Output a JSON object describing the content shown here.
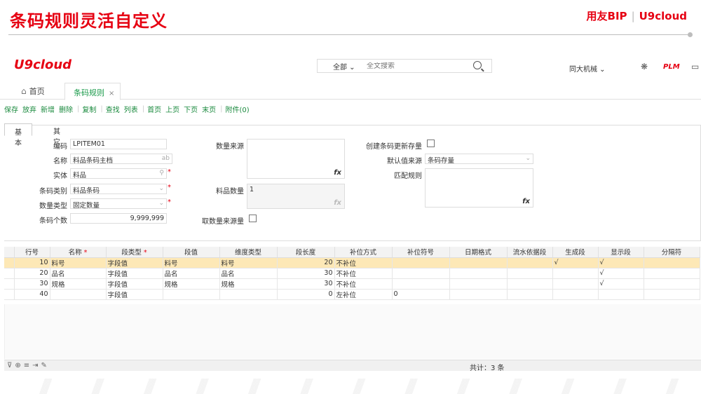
{
  "slide": {
    "title": "条码规则灵活自定义",
    "brand_bip": "用友BIP",
    "brand_u9": "U9cloud"
  },
  "app": {
    "logo": "U9cloud",
    "search": {
      "scope": "全部",
      "placeholder": "全文搜索"
    },
    "org": "同大机械",
    "plm": "PLM"
  },
  "tabs": {
    "home": "首页",
    "active": "条码规则"
  },
  "toolbar": [
    "保存",
    "放弃",
    "新增",
    "删除",
    "复制",
    "查找",
    "列表",
    "首页",
    "上页",
    "下页",
    "末页",
    "附件(0)"
  ],
  "subtabs": {
    "basic": "基本",
    "other": "其它"
  },
  "form": {
    "code_label": "编码",
    "code_value": "LPITEM01",
    "name_label": "名称",
    "name_value": "料品条码主档",
    "name_suffix": "ab",
    "entity_label": "实体",
    "entity_value": "料品",
    "barcode_type_label": "条码类别",
    "barcode_type_value": "料品条码",
    "qty_type_label": "数量类型",
    "qty_type_value": "固定数量",
    "barcode_count_label": "条码个数",
    "barcode_count_value": "9,999,999",
    "qty_source_label": "数量来源",
    "item_qty_label": "料品数量",
    "item_qty_value": "1",
    "take_qty_label": "取数量来源量",
    "create_update_label": "创建条码更新存量",
    "default_source_label": "默认值来源",
    "default_source_value": "条码存量",
    "match_rule_label": "匹配规则",
    "fx": "fx"
  },
  "grid": {
    "columns": [
      "行号",
      "名称",
      "段类型",
      "段值",
      "维度类型",
      "段长度",
      "补位方式",
      "补位符号",
      "日期格式",
      "流水依据段",
      "生成段",
      "显示段",
      "分隔符"
    ],
    "required_columns": [
      1,
      2
    ],
    "rows": [
      [
        "10",
        "料号",
        "字段值",
        "料号",
        "料号",
        "20",
        "不补位",
        "",
        "",
        "",
        "√",
        "√",
        ""
      ],
      [
        "20",
        "品名",
        "字段值",
        "品名",
        "品名",
        "30",
        "不补位",
        "",
        "",
        "",
        "",
        "√",
        ""
      ],
      [
        "30",
        "规格",
        "字段值",
        "规格",
        "规格",
        "30",
        "不补位",
        "",
        "",
        "",
        "",
        "√",
        ""
      ],
      [
        "40",
        "",
        "字段值",
        "",
        "",
        "0",
        "左补位",
        "0",
        "",
        "",
        "",
        "",
        ""
      ]
    ],
    "selected_row": 0,
    "total": "共计：3 条"
  }
}
